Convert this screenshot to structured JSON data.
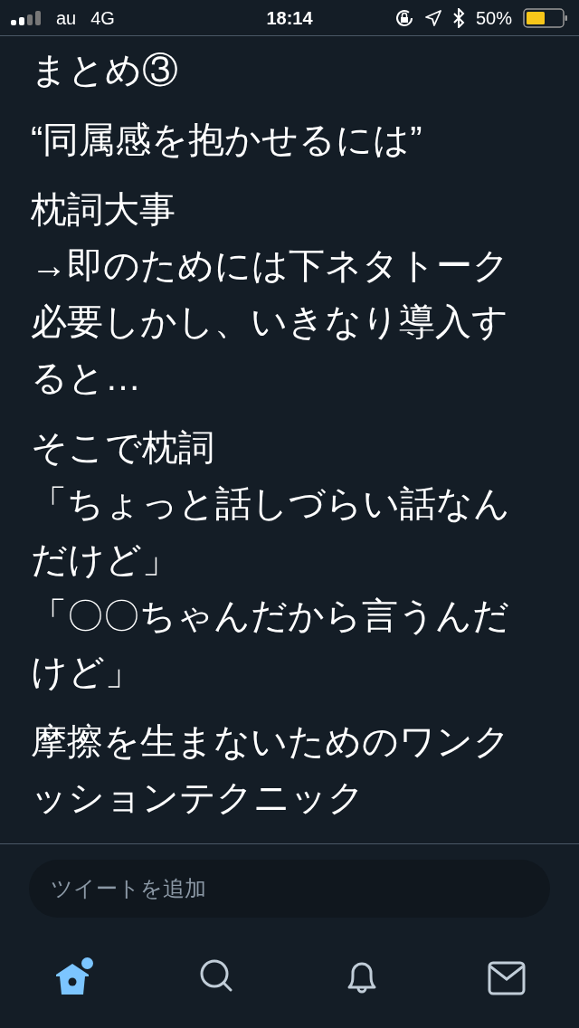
{
  "status_bar": {
    "carrier": "au",
    "network": "4G",
    "time": "18:14",
    "battery": "50%"
  },
  "tweet": {
    "paragraphs": [
      {
        "lines": [
          "まとめ③"
        ]
      },
      {
        "lines": [
          "“同属感を抱かせるには”"
        ]
      },
      {
        "lines": [
          "枕詞大事",
          "→即のためには下ネタトーク",
          "必要しかし、いきなり導入す",
          "ると…"
        ]
      },
      {
        "lines": [
          "そこで枕詞",
          "「ちょっと話しづらい話なん",
          "だけど」",
          "「〇〇ちゃんだから言うんだ",
          "けど」"
        ]
      },
      {
        "lines": [
          "摩擦を生まないためのワンク",
          "ッションテクニック"
        ]
      }
    ]
  },
  "reply_field": {
    "placeholder": "ツイートを追加"
  },
  "tabs": [
    {
      "kind": "home",
      "selected": true,
      "unread": true
    },
    {
      "kind": "search",
      "selected": false,
      "unread": false
    },
    {
      "kind": "notifications",
      "selected": false,
      "unread": false
    },
    {
      "kind": "messages",
      "selected": false,
      "unread": false
    }
  ]
}
